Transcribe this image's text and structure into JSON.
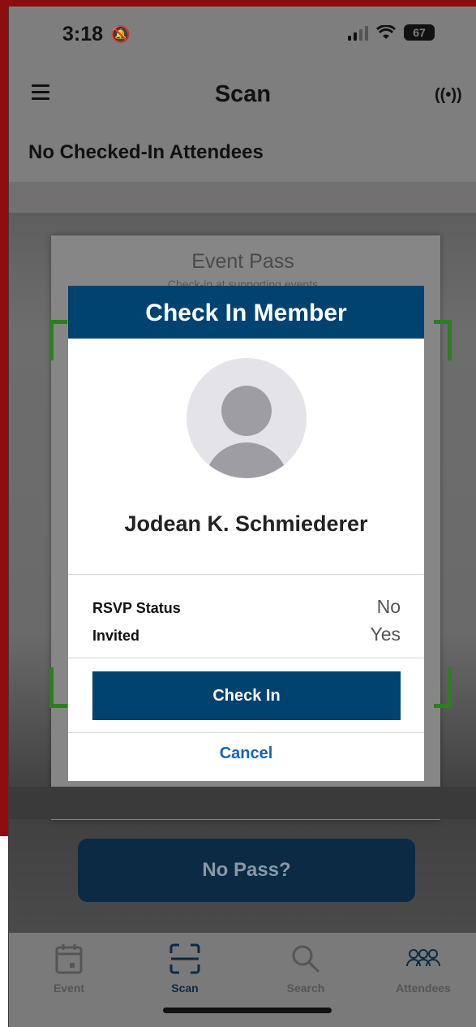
{
  "status_bar": {
    "time": "3:18",
    "battery": "67"
  },
  "nav": {
    "title": "Scan"
  },
  "subtitle": "No Checked-In Attendees",
  "camera": {
    "pass_title": "Event Pass",
    "pass_subtitle": "Check-in at supporting events"
  },
  "no_pass_label": "No Pass?",
  "modal": {
    "title": "Check In Member",
    "member_name": "Jodean K. Schmiederer",
    "rows": [
      {
        "label": "RSVP Status",
        "value": "No"
      },
      {
        "label": "Invited",
        "value": "Yes"
      }
    ],
    "check_in_label": "Check In",
    "cancel_label": "Cancel"
  },
  "tabs": [
    {
      "label": "Event",
      "icon": "calendar-icon"
    },
    {
      "label": "Scan",
      "icon": "scan-icon",
      "active": true
    },
    {
      "label": "Search",
      "icon": "search-icon"
    },
    {
      "label": "Attendees",
      "icon": "people-icon"
    }
  ],
  "colors": {
    "primary": "#004270",
    "link": "#1964b4",
    "frame": "#8c0d0d"
  }
}
